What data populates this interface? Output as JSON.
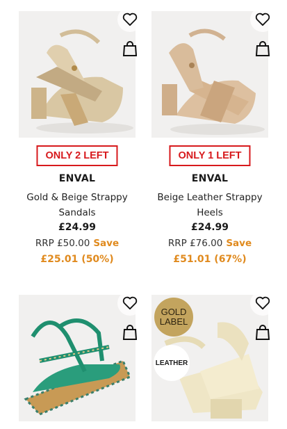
{
  "products": [
    {
      "badge": "ONLY 2 LEFT",
      "brand": "ENVAL",
      "name_line1": "Gold & Beige Strappy",
      "name_line2": "Sandals",
      "price": "£24.99",
      "rrp": "RRP £50.00",
      "save_label": "Save",
      "saving": "£25.01 (50%)"
    },
    {
      "badge": "ONLY 1 LEFT",
      "brand": "ENVAL",
      "name_line1": "Beige Leather Strappy",
      "name_line2": "Heels",
      "price": "£24.99",
      "rrp": "RRP £76.00",
      "save_label": "Save",
      "saving": "£51.01 (67%)"
    },
    {},
    {
      "gold_label_line1": "GOLD",
      "gold_label_line2": "LABEL",
      "material_badge": "LEATHER"
    }
  ],
  "icons": {
    "favourite": "heart-outline-icon",
    "basket": "shopping-bag-icon"
  },
  "colors": {
    "badge_red": "#d7191c",
    "save_orange": "#e08a1e",
    "gold_label": "#c3a45e"
  }
}
